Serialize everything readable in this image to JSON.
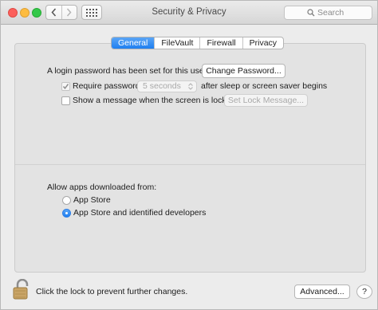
{
  "window": {
    "title": "Security & Privacy",
    "search_placeholder": "Search"
  },
  "tabs": [
    {
      "label": "General",
      "active": true
    },
    {
      "label": "FileVault",
      "active": false
    },
    {
      "label": "Firewall",
      "active": false
    },
    {
      "label": "Privacy",
      "active": false
    }
  ],
  "general": {
    "login_password_text": "A login password has been set for this user",
    "change_password_label": "Change Password...",
    "require_password": {
      "label": "Require password",
      "checked": true,
      "enabled": false
    },
    "require_password_delay": "5 seconds",
    "require_password_suffix": "after sleep or screen saver begins",
    "show_message": {
      "label": "Show a message when the screen is locked",
      "checked": false
    },
    "set_lock_message_label": "Set Lock Message..."
  },
  "downloads": {
    "heading": "Allow apps downloaded from:",
    "options": [
      {
        "label": "App Store",
        "selected": false
      },
      {
        "label": "App Store and identified developers",
        "selected": true
      }
    ]
  },
  "footer": {
    "lock_text": "Click the lock to prevent further changes.",
    "advanced_label": "Advanced...",
    "help_label": "?"
  },
  "colors": {
    "accent": "#1f7ff0",
    "window_background": "#ececec",
    "panel_background": "#e3e3e3"
  },
  "icons": [
    "back-icon",
    "forward-icon",
    "show-all-grid-icon",
    "search-icon",
    "checkmark-icon",
    "popup-arrows-icon",
    "lock-icon"
  ]
}
